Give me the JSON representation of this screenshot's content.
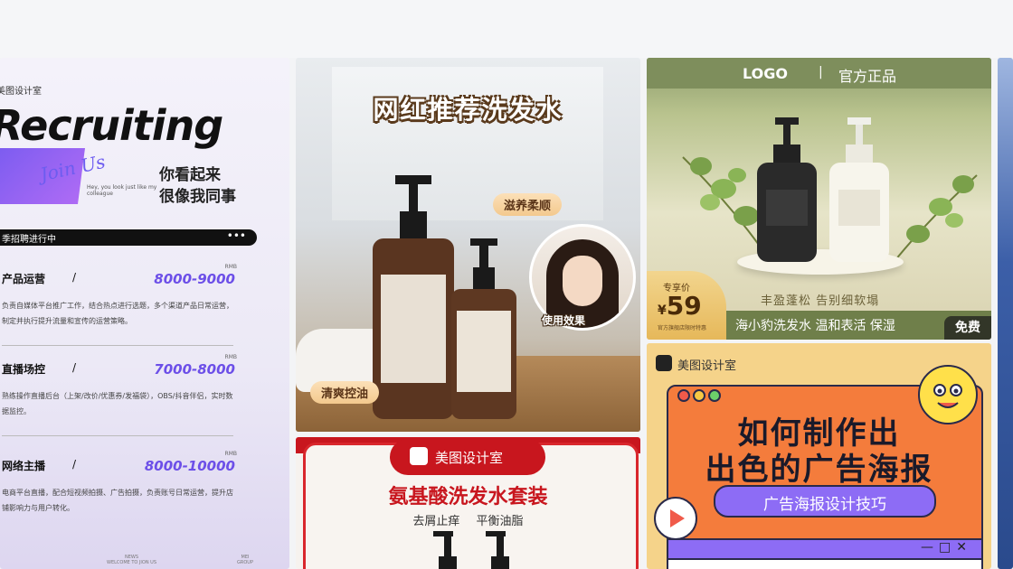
{
  "cards": {
    "recruiting": {
      "brand": "美图设计室",
      "title": "Recruiting",
      "script": "Join Us",
      "tiny_text": "Hey, you look just like my colleague",
      "looks_like": [
        "你看起来",
        "很像我同事"
      ],
      "banner": "季招聘进行中",
      "banner_dots": "•••",
      "jobs": [
        {
          "name": "产品运营",
          "slash": "/",
          "rmb": "RMB",
          "salary": "8000-9000",
          "desc": "负责自媒体平台推广工作，结合热点进行选题，多个渠道产品日常运营，制定并执行提升流量和宣传的运营策略。"
        },
        {
          "name": "直播场控",
          "slash": "/",
          "rmb": "RMB",
          "salary": "7000-8000",
          "desc": "熟练操作直播后台（上架/改价/优惠券/发福袋），OBS/抖音伴侣，实时数据监控。"
        },
        {
          "name": "网络主播",
          "slash": "/",
          "rmb": "RMB",
          "salary": "8000-10000",
          "desc": "电商平台直播，配合短视频拍摄、广告拍摄，负责账号日常运营，提升店铺影响力与用户转化。"
        }
      ],
      "footer_left": [
        "NEWS",
        "WELCOME TO JION US"
      ],
      "footer_right": [
        "MEI",
        "GROUP"
      ]
    },
    "shampoo_photo": {
      "title": "网红推荐洗发水",
      "tag_nourish": "滋养柔顺",
      "tag_oil": "清爽控油",
      "effect": "使用效果"
    },
    "green_shampoo": {
      "logo": "LOGO",
      "separator": "|",
      "official": "官方正品",
      "price_label": "专享价",
      "price": "59",
      "price_prefix": "¥",
      "price_sub": "官方旗舰店限时特惠",
      "slogan": "丰盈蓬松 告别细软塌",
      "bar_text": "海小豹洗发水 温和表活 保湿",
      "free_badge": "免费"
    },
    "amino": {
      "brand": "美图设计室",
      "title": "氨基酸洗发水套装",
      "subtitle": "去屑止痒 平衡油脂"
    },
    "poster_tips": {
      "brand": "美图设计室",
      "line1": "如何制作出",
      "line2": "出色的广告海报",
      "button": "广告海报设计技巧",
      "window_controls": "—□✕"
    }
  },
  "colors": {
    "purple": "#6c4fe8",
    "red": "#c8161e",
    "olive": "#7e8e5c",
    "orange": "#f47c3c",
    "violet": "#8d6cf5"
  }
}
